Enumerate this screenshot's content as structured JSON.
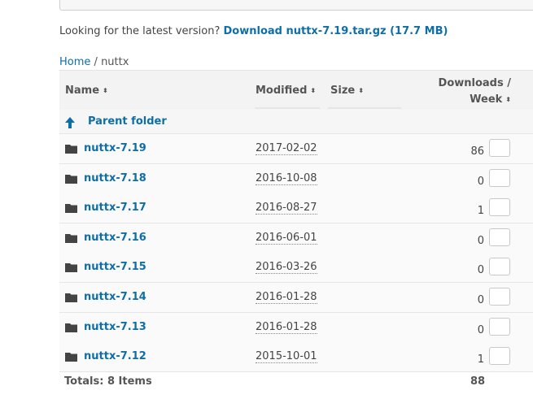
{
  "latest": {
    "prefix": "Looking for the latest version?",
    "link": "Download nuttx-7.19.tar.gz (17.7 MB)"
  },
  "breadcrumb": {
    "home": "Home",
    "sep": "/",
    "current": "nuttx"
  },
  "table": {
    "headers": {
      "name": "Name",
      "modified": "Modified",
      "size": "Size",
      "downloads_line1": "Downloads /",
      "downloads_line2": "Week"
    },
    "sort_glyph": "⬍",
    "parent": "Parent folder",
    "rows": [
      {
        "name": "nuttx-7.19",
        "modified": "2017-02-02",
        "downloads": "86"
      },
      {
        "name": "nuttx-7.18",
        "modified": "2016-10-08",
        "downloads": "0"
      },
      {
        "name": "nuttx-7.17",
        "modified": "2016-08-27",
        "downloads": "1"
      },
      {
        "name": "nuttx-7.16",
        "modified": "2016-06-01",
        "downloads": "0"
      },
      {
        "name": "nuttx-7.15",
        "modified": "2016-03-26",
        "downloads": "0"
      },
      {
        "name": "nuttx-7.14",
        "modified": "2016-01-28",
        "downloads": "0"
      },
      {
        "name": "nuttx-7.13",
        "modified": "2016-01-28",
        "downloads": "0"
      },
      {
        "name": "nuttx-7.12",
        "modified": "2015-10-01",
        "downloads": "1"
      }
    ],
    "totals_label": "Totals: 8 Items",
    "totals_downloads": "88"
  },
  "colors": {
    "link": "#0e6ea8",
    "header_bg": "#f3f3f3",
    "row_bg": "#fafafa"
  },
  "icons": {
    "folder": "folder-icon",
    "up": "up-arrow-icon"
  }
}
